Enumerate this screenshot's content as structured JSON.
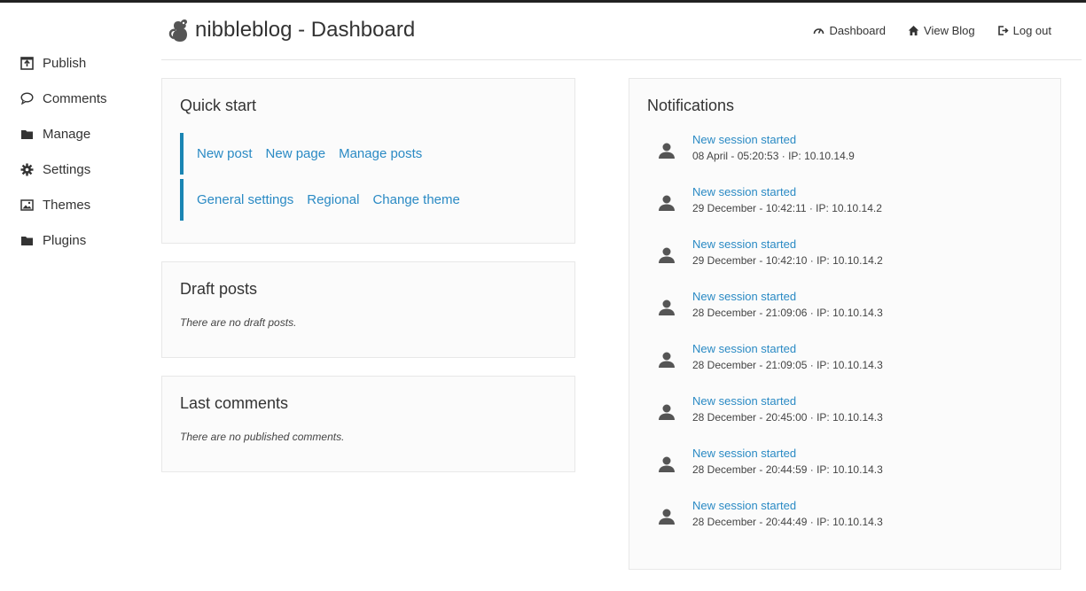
{
  "header": {
    "title": "nibbleblog - Dashboard",
    "nav": [
      {
        "label": "Dashboard",
        "icon": "dashboard-icon"
      },
      {
        "label": "View Blog",
        "icon": "home-icon"
      },
      {
        "label": "Log out",
        "icon": "logout-icon"
      }
    ]
  },
  "sidebar": {
    "items": [
      {
        "label": "Publish",
        "icon": "publish-icon"
      },
      {
        "label": "Comments",
        "icon": "comment-icon"
      },
      {
        "label": "Manage",
        "icon": "folder-icon"
      },
      {
        "label": "Settings",
        "icon": "gear-icon"
      },
      {
        "label": "Themes",
        "icon": "image-icon"
      },
      {
        "label": "Plugins",
        "icon": "folder-icon"
      }
    ]
  },
  "quick_start": {
    "title": "Quick start",
    "row1": [
      "New post",
      "New page",
      "Manage posts"
    ],
    "row2": [
      "General settings",
      "Regional",
      "Change theme"
    ]
  },
  "drafts": {
    "title": "Draft posts",
    "empty": "There are no draft posts."
  },
  "comments": {
    "title": "Last comments",
    "empty": "There are no published comments."
  },
  "notifications": {
    "title": "Notifications",
    "items": [
      {
        "title": "New session started",
        "meta": "08 April - 05:20:53 · IP: 10.10.14.9"
      },
      {
        "title": "New session started",
        "meta": "29 December - 10:42:11 · IP: 10.10.14.2"
      },
      {
        "title": "New session started",
        "meta": "29 December - 10:42:10 · IP: 10.10.14.2"
      },
      {
        "title": "New session started",
        "meta": "28 December - 21:09:06 · IP: 10.10.14.3"
      },
      {
        "title": "New session started",
        "meta": "28 December - 21:09:05 · IP: 10.10.14.3"
      },
      {
        "title": "New session started",
        "meta": "28 December - 20:45:00 · IP: 10.10.14.3"
      },
      {
        "title": "New session started",
        "meta": "28 December - 20:44:59 · IP: 10.10.14.3"
      },
      {
        "title": "New session started",
        "meta": "28 December - 20:44:49 · IP: 10.10.14.3"
      }
    ]
  },
  "colors": {
    "link": "#2a8ac4",
    "accent_border": "#1a85b3",
    "text": "#333333"
  }
}
